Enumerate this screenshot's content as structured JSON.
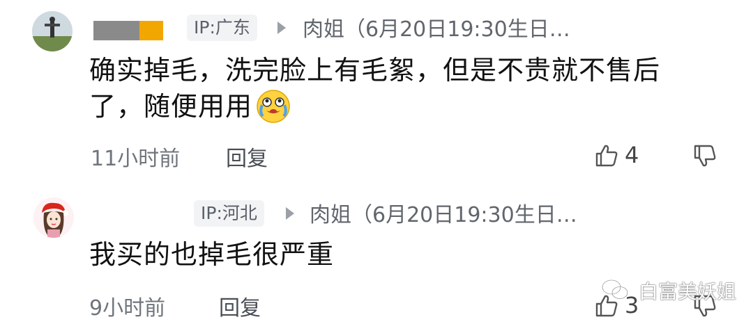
{
  "comments": [
    {
      "ip_label": "IP:广东",
      "reply_to": "肉姐（6月20日19:30生日…",
      "text_line1": "确实掉毛，洗完脸上有毛絮，但是不贵就不售后",
      "text_line2": "了，随便用用",
      "time": "11小时前",
      "reply_label": "回复",
      "likes": "4"
    },
    {
      "ip_label": "IP:河北",
      "reply_to": "肉姐（6月20日19:30生日…",
      "text_line1": "我买的也掉毛很严重",
      "time": "9小时前",
      "reply_label": "回复",
      "likes": "3"
    }
  ],
  "emoji": "laughing-crying-emoji",
  "watermark": "白富美妖姐",
  "colors": {
    "name_mask_gray": "#8a8a8a",
    "name_mask_orange": "#f2a600"
  }
}
